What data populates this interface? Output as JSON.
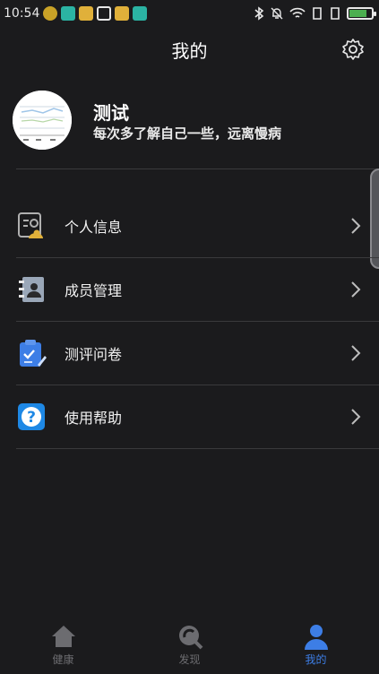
{
  "status_bar": {
    "time": "10:54"
  },
  "header": {
    "title": "我的"
  },
  "profile": {
    "name": "测试",
    "subtitle": "每次多了解自己一些，远离慢病"
  },
  "menu": [
    {
      "label": "个人信息",
      "icon": "personal-info-icon"
    },
    {
      "label": "成员管理",
      "icon": "member-contact-icon"
    },
    {
      "label": "测评问卷",
      "icon": "questionnaire-clipboard-icon"
    },
    {
      "label": "使用帮助",
      "icon": "help-question-icon"
    }
  ],
  "tabs": [
    {
      "label": "健康",
      "icon": "home-icon",
      "active": false
    },
    {
      "label": "发现",
      "icon": "discover-icon",
      "active": false
    },
    {
      "label": "我的",
      "icon": "user-icon",
      "active": true
    }
  ],
  "colors": {
    "background": "#1b1b1d",
    "accent": "#3d7ee6",
    "divider": "#3a3a3c",
    "tab_inactive": "#6c6c70"
  }
}
